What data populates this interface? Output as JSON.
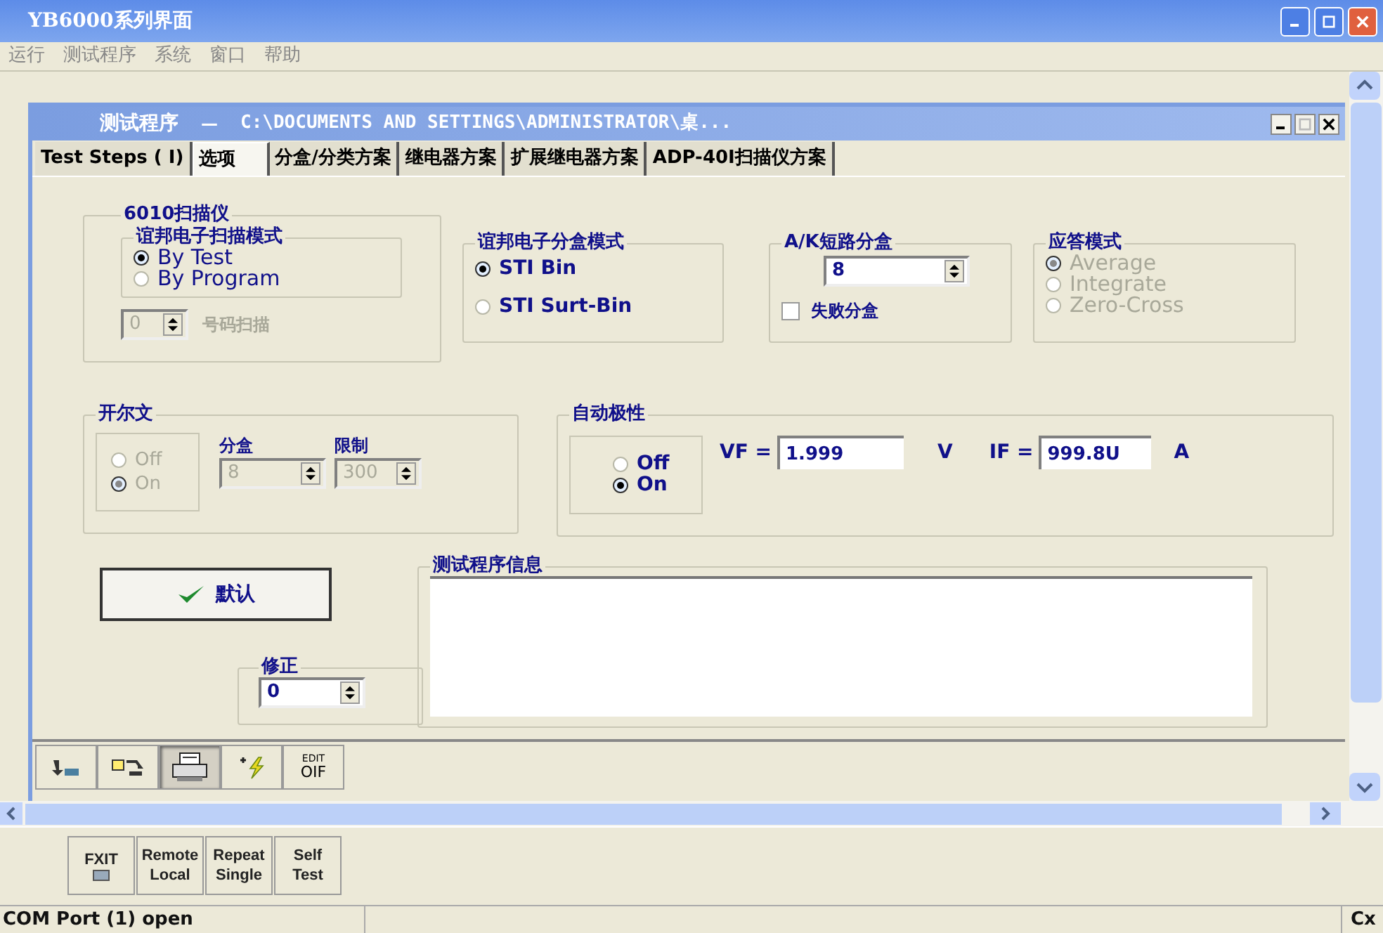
{
  "window": {
    "title": "YB6000系列界面"
  },
  "menu": [
    "运行",
    "测试程序",
    "系统",
    "窗口",
    "帮助"
  ],
  "child_window": {
    "title": "测试程序",
    "separator": "—",
    "path": "C:\\DOCUMENTS AND SETTINGS\\ADMINISTRATOR\\桌..."
  },
  "tabs": [
    {
      "label": "Test Steps ( I)",
      "selected": false
    },
    {
      "label": "选项",
      "selected": true
    },
    {
      "label": "分盒/分类方案",
      "selected": false
    },
    {
      "label": "继电器方案",
      "selected": false
    },
    {
      "label": "扩展继电器方案",
      "selected": false
    },
    {
      "label": "ADP-40I扫描仪方案",
      "selected": false
    }
  ],
  "scanner": {
    "title": "6010扫描仪",
    "mode_title": "谊邦电子扫描模式",
    "modes": [
      {
        "label": "By Test",
        "selected": true
      },
      {
        "label": "By Program",
        "selected": false
      }
    ],
    "number": {
      "value": "0",
      "label": "号码扫描",
      "disabled": true
    }
  },
  "bin_mode": {
    "title": "谊邦电子分盒模式",
    "options": [
      {
        "label": "STI Bin",
        "selected": true
      },
      {
        "label": "STI Surt-Bin",
        "selected": false
      }
    ]
  },
  "ak_short": {
    "title": "A/K短路分盒",
    "value": "8",
    "fail_bin": {
      "label": "失败分盒",
      "checked": false
    }
  },
  "response_mode": {
    "title": "应答模式",
    "disabled": true,
    "options": [
      {
        "label": "Average",
        "selected": true
      },
      {
        "label": "Integrate",
        "selected": false
      },
      {
        "label": "Zero-Cross",
        "selected": false
      }
    ]
  },
  "kelvin": {
    "title": "开尔文",
    "disabled": true,
    "options": [
      {
        "label": "Off",
        "selected": false
      },
      {
        "label": "On",
        "selected": true
      }
    ],
    "bin_label": "分盒",
    "bin_value": "8",
    "limit_label": "限制",
    "limit_value": "300"
  },
  "auto_polarity": {
    "title": "自动极性",
    "options": [
      {
        "label": "Off",
        "selected": false
      },
      {
        "label": "On",
        "selected": true
      }
    ],
    "vf_label": "VF =",
    "vf_value": "1.999",
    "vf_unit": "V",
    "if_label": "IF =",
    "if_value": "999.8U",
    "if_unit": "A"
  },
  "default_button": "默认",
  "correction": {
    "title": "修正",
    "value": "0"
  },
  "info": {
    "title": "测试程序信息"
  },
  "toolbar": [
    {
      "kind": "transfer",
      "pressed": false
    },
    {
      "kind": "swap",
      "pressed": false
    },
    {
      "kind": "printer",
      "pressed": true
    },
    {
      "kind": "spark",
      "pressed": false
    },
    {
      "kind": "text",
      "pressed": false,
      "top": "EDIT",
      "bottom": "OIF"
    }
  ],
  "bottom_buttons": [
    {
      "lines": [
        "FXIT"
      ],
      "icon": true
    },
    {
      "lines": [
        "Remote",
        "Local"
      ],
      "icon": false
    },
    {
      "lines": [
        "Repeat",
        "Single"
      ],
      "icon": false
    },
    {
      "lines": [
        "Self",
        "Test"
      ],
      "icon": false
    }
  ],
  "status_bar": {
    "message": "COM Port (1) open",
    "indicator": "Cx"
  }
}
